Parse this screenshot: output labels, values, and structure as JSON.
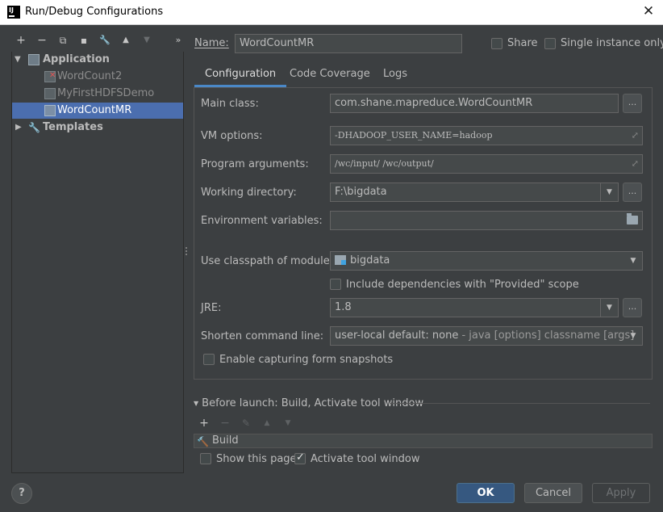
{
  "window": {
    "title": "Run/Debug Configurations",
    "app_icon_text": "IJ"
  },
  "toolbar": {
    "add": "+",
    "remove": "−",
    "copy": "⧉",
    "save": "▪",
    "edit_defaults": "🔧",
    "move_up": "▲",
    "move_down": "▼",
    "more": "»"
  },
  "tree": {
    "application": "Application",
    "items": [
      "WordCount2",
      "MyFirstHDFSDemo",
      "WordCountMR"
    ],
    "templates": "Templates"
  },
  "name": {
    "label": "Name:",
    "value": "WordCountMR"
  },
  "share": {
    "label": "Share",
    "checked": false
  },
  "single_instance": {
    "label": "Single instance only",
    "checked": false
  },
  "tabs": [
    "Configuration",
    "Code Coverage",
    "Logs"
  ],
  "config": {
    "main_class": {
      "label": "Main class:",
      "value": "com.shane.mapreduce.WordCountMR"
    },
    "vm_options": {
      "label": "VM options:",
      "value": "-DHADOOP_USER_NAME=hadoop"
    },
    "program_arguments": {
      "label": "Program arguments:",
      "value": "/wc/input/ /wc/output/"
    },
    "working_directory": {
      "label": "Working directory:",
      "value": "F:\\bigdata"
    },
    "environment_variables": {
      "label": "Environment variables:",
      "value": ""
    },
    "classpath_module": {
      "label": "Use classpath of module:",
      "value": "bigdata"
    },
    "include_provided": {
      "label": "Include dependencies with \"Provided\" scope",
      "checked": false
    },
    "jre": {
      "label": "JRE:",
      "value": "1.8"
    },
    "shorten_cmd": {
      "label": "Shorten command line:",
      "value": "user-local default: none",
      "sub": " - java [options] classname [args]"
    },
    "form_snapshots": {
      "label": "Enable capturing form snapshots",
      "checked": false
    },
    "browse": "..."
  },
  "before_launch": {
    "title": "Before launch: Build, Activate tool window",
    "item": "Build",
    "show_page": {
      "label": "Show this page",
      "checked": false
    },
    "activate_tool_window": {
      "label": "Activate tool window",
      "checked": true
    }
  },
  "buttons": {
    "help": "?",
    "ok": "OK",
    "cancel": "Cancel",
    "apply": "Apply"
  },
  "colors": {
    "background": "#3c3f41",
    "selection": "#4b6eaf",
    "ok_button": "#365880",
    "tab_underline": "#4a88c7"
  }
}
